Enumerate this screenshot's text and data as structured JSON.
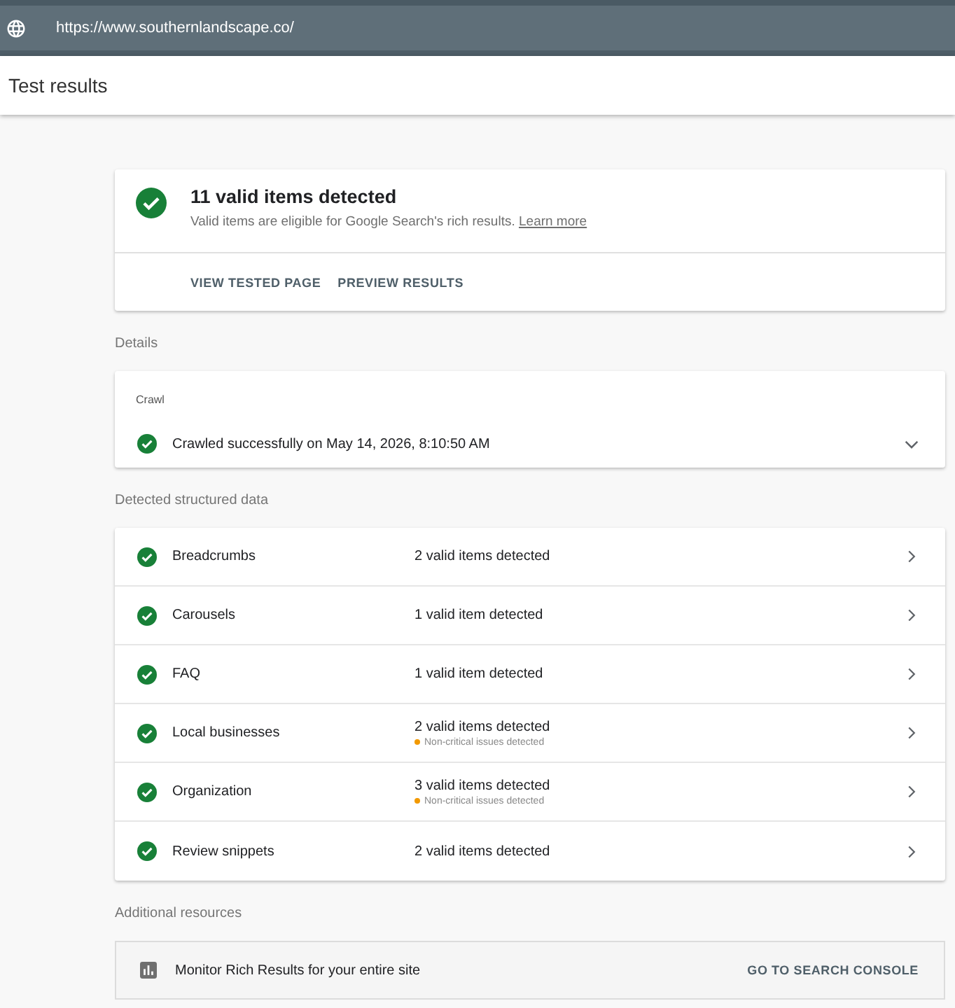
{
  "address_bar": {
    "url": "https://www.southernlandscape.co/"
  },
  "header": {
    "title": "Test results"
  },
  "summary": {
    "title": "11 valid items detected",
    "description": "Valid items are eligible for Google Search's rich results.",
    "link": "Learn more",
    "actions": [
      "VIEW TESTED PAGE",
      "PREVIEW RESULTS"
    ]
  },
  "details": {
    "heading": "Details",
    "crawl": {
      "label": "Crawl",
      "status": "Crawled successfully on May 14, 2026, 8:10:50 AM",
      "expanded": false
    }
  },
  "structured_data": {
    "heading": "Detected structured data",
    "items": [
      {
        "name": "Breadcrumbs",
        "result": "2 valid items detected"
      },
      {
        "name": "Carousels",
        "result": "1 valid item detected"
      },
      {
        "name": "FAQ",
        "result": "1 valid item detected"
      },
      {
        "name": "Local businesses",
        "result": "2 valid items detected",
        "note": "Non-critical issues detected"
      },
      {
        "name": "Organization",
        "result": "3 valid items detected",
        "note": "Non-critical issues detected"
      },
      {
        "name": "Review snippets",
        "result": "2 valid items detected"
      }
    ]
  },
  "resources": {
    "heading": "Additional resources",
    "items": [
      {
        "text": "Monitor Rich Results for your entire site",
        "action": "GO TO SEARCH CONSOLE"
      }
    ]
  }
}
